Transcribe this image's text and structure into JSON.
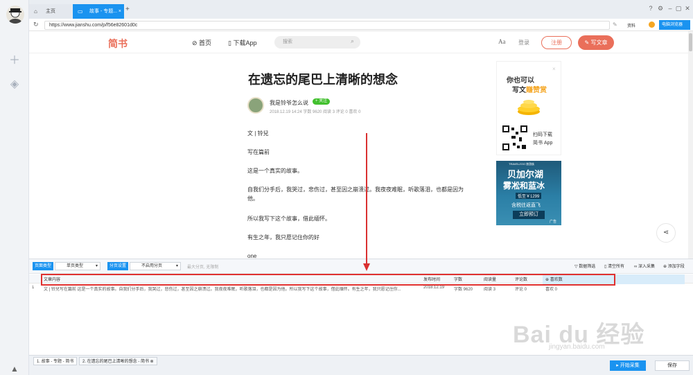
{
  "tabs": [
    {
      "label": "主页"
    },
    {
      "label": "故事 - 专题..."
    }
  ],
  "browser": {
    "url": "https://www.jianshu.com/p/f56e82601d0c",
    "right_items": [
      "资料",
      "电脑浏览器"
    ]
  },
  "site": {
    "logo": "简书",
    "nav_home": "首页",
    "nav_app": "下载App",
    "search_placeholder": "搜索",
    "font_icon": "Aa",
    "login": "登录",
    "signup": "注册",
    "write": "写文章"
  },
  "article": {
    "title": "在遗忘的尾巴上清晰的想念",
    "author": "我是铃爷怎么说",
    "follow": "+ 关注",
    "meta": "2018.12.19 14:24  字数 9620  阅读 3  评论 0  喜欢 0",
    "paragraphs": [
      "文 | 铃兒",
      "写在篇前",
      "这是一个真实的故事。",
      "自我们分手后，我哭过，悲伤过，甚至因之崩溃过。我夜夜难眠，听歌落泪，也都是因为他。",
      "所以我写下这个故事，借此缅怀。",
      "有生之年，我只愿记住你的好",
      "one"
    ]
  },
  "ads": {
    "ad1_line1": "你也可以",
    "ad1_line2": "写文",
    "ad1_highlight": "赚赞赏",
    "qr_line1": "扫码下载",
    "qr_line2": "简书 App",
    "ad2_brand": "TRAVELZOO 旅游族",
    "ad2_title1": "贝加尔湖",
    "ad2_title2": "雾凇和蓝冰",
    "ad2_price": "低至￥1299",
    "ad2_sub": "含税往返直飞",
    "ad2_btn": "立即预订",
    "ad2_tag": "广告"
  },
  "collector": {
    "page_type_label": "页面类型",
    "page_type_value": "单页类型",
    "paging_label": "分页设置",
    "paging_value": "不启用分页",
    "page_hint": "最大分页, 无限制",
    "actions": [
      "数据筛选",
      "清空所有",
      "深入采集",
      "添加字段"
    ],
    "columns": [
      "文章内容",
      "发布时间",
      "字数",
      "阅读量",
      "评论数",
      "喜欢数"
    ],
    "rows": [
      {
        "index": "1",
        "content": "文 | 铃兒写在篇前 这是一个真实的故事。自我们分手后，我哭过，悲伤过，甚至因之崩溃过。我夜夜难眠，听歌落泪，也都是因为他。所以我写下这个故事，借此缅怀。有生之年，我只愿记住你...",
        "date": "2018.12.19",
        "words": "字数 9620",
        "reads": "阅读 3",
        "comments": "评论 0",
        "likes": "喜欢 0"
      }
    ]
  },
  "bottom": {
    "tabs": [
      "1. 故事 - 专题 - 简书",
      "2. 在遗忘的尾巴上清晰的想念 - 简书"
    ],
    "start": "开始采集",
    "save": "保存"
  },
  "watermark": {
    "main": "Bai du 经验",
    "sub": "jingyan.baidu.com"
  },
  "colors": {
    "accent": "#1a93f0",
    "brand": "#ea6f5a",
    "highlight_box": "#e0302f"
  }
}
